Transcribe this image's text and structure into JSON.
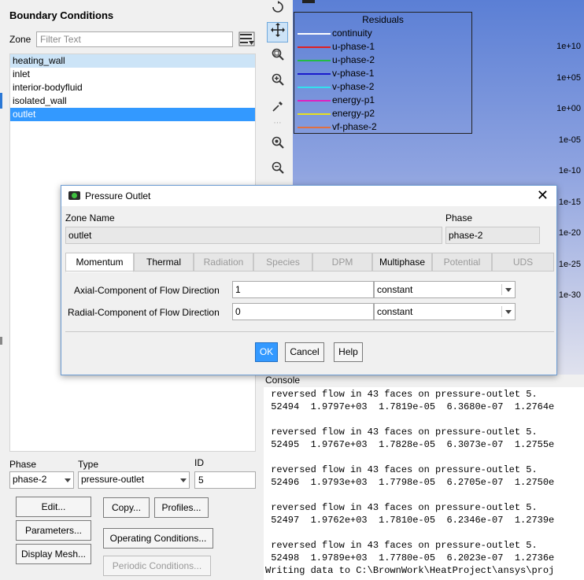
{
  "boundary_conditions": {
    "title": "Boundary Conditions",
    "zone_label": "Zone",
    "filter_placeholder": "Filter Text",
    "zones": [
      "heating_wall",
      "inlet",
      "interior-bodyfluid",
      "isolated_wall",
      "outlet"
    ],
    "phase_label": "Phase",
    "phase_value": "phase-2",
    "type_label": "Type",
    "type_value": "pressure-outlet",
    "id_label": "ID",
    "id_value": "5",
    "buttons": {
      "edit": "Edit...",
      "copy": "Copy...",
      "profiles": "Profiles...",
      "parameters": "Parameters...",
      "operating_conditions": "Operating Conditions...",
      "display_mesh": "Display Mesh...",
      "periodic_conditions": "Periodic Conditions..."
    }
  },
  "graphics": {
    "legend_title": "Residuals",
    "legend": [
      {
        "name": "continuity",
        "color": "#ffffff"
      },
      {
        "name": "u-phase-1",
        "color": "#e02020"
      },
      {
        "name": "u-phase-2",
        "color": "#22bb44"
      },
      {
        "name": "v-phase-1",
        "color": "#1a1acc"
      },
      {
        "name": "v-phase-2",
        "color": "#33e0ee"
      },
      {
        "name": "energy-p1",
        "color": "#e020c0"
      },
      {
        "name": "energy-p2",
        "color": "#e8e020"
      },
      {
        "name": "vf-phase-2",
        "color": "#e07040"
      }
    ],
    "y_ticks": [
      "1e+10",
      "1e+05",
      "1e+00",
      "1e-05",
      "1e-10",
      "1e-15",
      "1e-20",
      "1e-25",
      "1e-30"
    ]
  },
  "console": {
    "title": "Console",
    "lines": [
      "reversed flow in 43 faces on pressure-outlet 5.",
      "52494  1.9797e+03  1.7819e-05  6.3680e-07  1.2764e",
      "",
      "reversed flow in 43 faces on pressure-outlet 5.",
      "52495  1.9767e+03  1.7828e-05  6.3073e-07  1.2755e",
      "",
      "reversed flow in 43 faces on pressure-outlet 5.",
      "52496  1.9793e+03  1.7798e-05  6.2705e-07  1.2750e",
      "",
      "reversed flow in 43 faces on pressure-outlet 5.",
      "52497  1.9762e+03  1.7810e-05  6.2346e-07  1.2739e",
      "",
      "reversed flow in 43 faces on pressure-outlet 5.",
      "52498  1.9789e+03  1.7780e-05  6.2023e-07  1.2736e"
    ],
    "last_line": "Writing data to C:\\BrownWork\\HeatProject\\ansys\\proj"
  },
  "dialog": {
    "title": "Pressure Outlet",
    "zone_name_label": "Zone Name",
    "zone_name_value": "outlet",
    "phase_label": "Phase",
    "phase_value": "phase-2",
    "tabs": [
      "Momentum",
      "Thermal",
      "Radiation",
      "Species",
      "DPM",
      "Multiphase",
      "Potential",
      "UDS"
    ],
    "axial_label": "Axial-Component of Flow Direction",
    "axial_value": "1",
    "axial_method": "constant",
    "radial_label": "Radial-Component of Flow Direction",
    "radial_value": "0",
    "radial_method": "constant",
    "ok": "OK",
    "cancel": "Cancel",
    "help": "Help",
    "close_glyph": "✕"
  }
}
